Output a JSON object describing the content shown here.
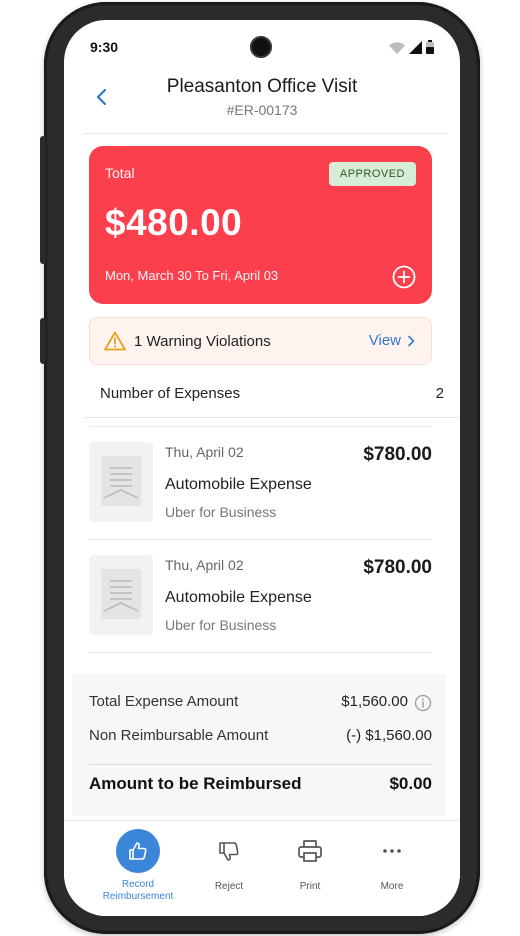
{
  "status_bar": {
    "time": "9:30"
  },
  "header": {
    "title": "Pleasanton Office Visit",
    "report_id": "#ER-00173"
  },
  "summary_card": {
    "label": "Total",
    "status_badge": "APPROVED",
    "amount": "$480.00",
    "date_range": "Mon, March 30 To Fri, April 03",
    "background_color": "#fc3f4d"
  },
  "warning": {
    "text": "1 Warning Violations",
    "view_label": "View"
  },
  "expenses_count": {
    "label": "Number of Expenses",
    "count": "2"
  },
  "expenses": [
    {
      "date": "Thu, April 02",
      "amount": "$780.00",
      "category": "Automobile Expense",
      "vendor": "Uber for Business"
    },
    {
      "date": "Thu, April 02",
      "amount": "$780.00",
      "category": "Automobile Expense",
      "vendor": "Uber for Business"
    }
  ],
  "totals": {
    "total_expense": {
      "label": "Total Expense Amount",
      "value": "$1,560.00"
    },
    "non_reimbursable": {
      "label": "Non Reimbursable Amount",
      "value": "(-) $1,560.00"
    },
    "to_reimburse": {
      "label": "Amount to be Reimbursed",
      "value": "$0.00"
    }
  },
  "tabbar": [
    {
      "label": "Record Reimbursement",
      "icon": "thumbs-up-icon"
    },
    {
      "label": "Reject",
      "icon": "thumbs-down-icon"
    },
    {
      "label": "Print",
      "icon": "printer-icon"
    },
    {
      "label": "More",
      "icon": "more-icon"
    }
  ],
  "colors": {
    "accent": "#3b86d9",
    "link": "#2f78c8",
    "warning_bg": "#fef3ef",
    "badge_bg": "#d7ecd7"
  }
}
